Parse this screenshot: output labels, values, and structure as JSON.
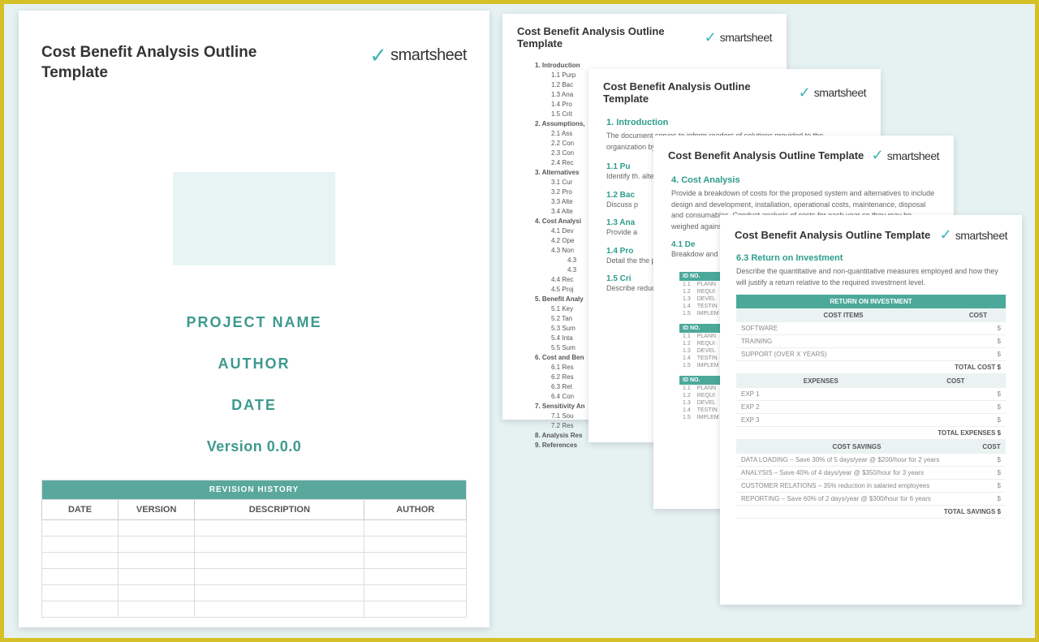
{
  "brand": "smartsheet",
  "template_title": "Cost Benefit Analysis Outline Template",
  "cover": {
    "project": "PROJECT NAME",
    "author": "AUTHOR",
    "date": "DATE",
    "version": "Version 0.0.0",
    "revision_title": "REVISION HISTORY",
    "revision_cols": [
      "DATE",
      "VERSION",
      "DESCRIPTION",
      "AUTHOR"
    ],
    "blank_rows": 6
  },
  "outline": [
    {
      "n": "1.",
      "t": "Introduction",
      "c": [
        {
          "n": "1.1",
          "t": "Purp"
        },
        {
          "n": "1.2",
          "t": "Bac"
        },
        {
          "n": "1.3",
          "t": "Ana"
        },
        {
          "n": "1.4",
          "t": "Pro"
        },
        {
          "n": "1.5",
          "t": "Crit"
        }
      ]
    },
    {
      "n": "2.",
      "t": "Assumptions,",
      "c": [
        {
          "n": "2.1",
          "t": "Ass"
        },
        {
          "n": "2.2",
          "t": "Con"
        },
        {
          "n": "2.3",
          "t": "Con"
        },
        {
          "n": "2.4",
          "t": "Rec"
        }
      ]
    },
    {
      "n": "3.",
      "t": "Alternatives",
      "c": [
        {
          "n": "3.1",
          "t": "Cur"
        },
        {
          "n": "3.2",
          "t": "Pro"
        },
        {
          "n": "3.3",
          "t": "Alte"
        },
        {
          "n": "3.4",
          "t": "Alte"
        }
      ]
    },
    {
      "n": "4.",
      "t": "Cost Analysi",
      "c": [
        {
          "n": "4.1",
          "t": "Dev"
        },
        {
          "n": "4.2",
          "t": "Ope"
        },
        {
          "n": "4.3",
          "t": "Non",
          "c": [
            {
              "n": "4.3",
              "t": ""
            },
            {
              "n": "4.3",
              "t": ""
            }
          ]
        },
        {
          "n": "4.4",
          "t": "Rec"
        },
        {
          "n": "4.5",
          "t": "Proj"
        }
      ]
    },
    {
      "n": "5.",
      "t": "Benefit Analy",
      "c": [
        {
          "n": "5.1",
          "t": "Key"
        },
        {
          "n": "5.2",
          "t": "Tan"
        },
        {
          "n": "5.3",
          "t": "Sum"
        },
        {
          "n": "5.4",
          "t": "Inta"
        },
        {
          "n": "5.5",
          "t": "Sum"
        }
      ]
    },
    {
      "n": "6.",
      "t": "Cost and Ben",
      "c": [
        {
          "n": "6.1",
          "t": "Res"
        },
        {
          "n": "6.2",
          "t": "Res"
        },
        {
          "n": "6.3",
          "t": "Ret"
        },
        {
          "n": "6.4",
          "t": "Con"
        }
      ]
    },
    {
      "n": "7.",
      "t": "Sensitivity An",
      "c": [
        {
          "n": "7.1",
          "t": "Sou"
        },
        {
          "n": "7.2",
          "t": "Res"
        }
      ]
    },
    {
      "n": "8.",
      "t": "Analysis Res",
      "c": []
    },
    {
      "n": "9.",
      "t": "References",
      "c": []
    }
  ],
  "page_intro": {
    "h": "1.  Introduction",
    "lead": "The document serves to inform readers of solutions provided to the organization by analyz",
    "subs": [
      {
        "h": "1.1  Pu",
        "b": "Identify th. alternative competitiv missions ."
      },
      {
        "h": "1.2  Bac",
        "b": "Discuss p"
      },
      {
        "h": "1.3  Ana",
        "b": "Provide a"
      },
      {
        "h": "1.4  Pro",
        "b": "Detail the the projec – provide"
      },
      {
        "h": "1.5  Cri",
        "b": "Describe reduced c"
      }
    ]
  },
  "page_cost": {
    "h": "4. Cost Analysis",
    "body": "Provide a breakdown of costs for the proposed system and alternatives to include design and development, installation, operational costs, maintenance, disposal and consumables. Conduct analysis of costs for each year so they may be weighed against resulting benefits.",
    "sub": "4.1   De",
    "sub_body": "Breakdow and softw in an outl",
    "id_rows": [
      [
        "1.1",
        "PLANN"
      ],
      [
        "1.2",
        "REQUI"
      ],
      [
        "1.3",
        "DEVEL"
      ],
      [
        "1.4",
        "TESTIN"
      ],
      [
        "1.5",
        "IMPLEM"
      ]
    ]
  },
  "page_roi": {
    "h": "6.3   Return on Investment",
    "body": "Describe the quantitative and non-quantitative measures employed and how they will justify a return relative to the required investment level.",
    "t1": {
      "title": "RETURN ON INVESTMENT",
      "cols": [
        "COST ITEMS",
        "COST"
      ],
      "rows": [
        [
          "SOFTWARE",
          "$"
        ],
        [
          "TRAINING",
          "$"
        ],
        [
          "SUPPORT (OVER X YEARS)",
          "$"
        ]
      ],
      "total": "TOTAL COST   $"
    },
    "t2": {
      "cols": [
        "EXPENSES",
        "COST"
      ],
      "rows": [
        [
          "EXP 1",
          "$"
        ],
        [
          "EXP 2",
          "$"
        ],
        [
          "EXP 3",
          "$"
        ]
      ],
      "total": "TOTAL EXPENSES   $"
    },
    "t3": {
      "cols": [
        "COST SAVINGS",
        "COST"
      ],
      "rows": [
        [
          "DATA LOADING – Save 30% of 5 days/year @ $200/hour for 2 years",
          "$"
        ],
        [
          "ANALYSIS – Save 40% of 4 days/year @ $350/hour for 3 years",
          "$"
        ],
        [
          "CUSTOMER RELATIONS – 35% reduction in salaried employees",
          "$"
        ],
        [
          "REPORTING – Save 60% of 2 days/year @ $300/hour for 6 years",
          "$"
        ]
      ],
      "total": "TOTAL SAVINGS   $"
    }
  }
}
